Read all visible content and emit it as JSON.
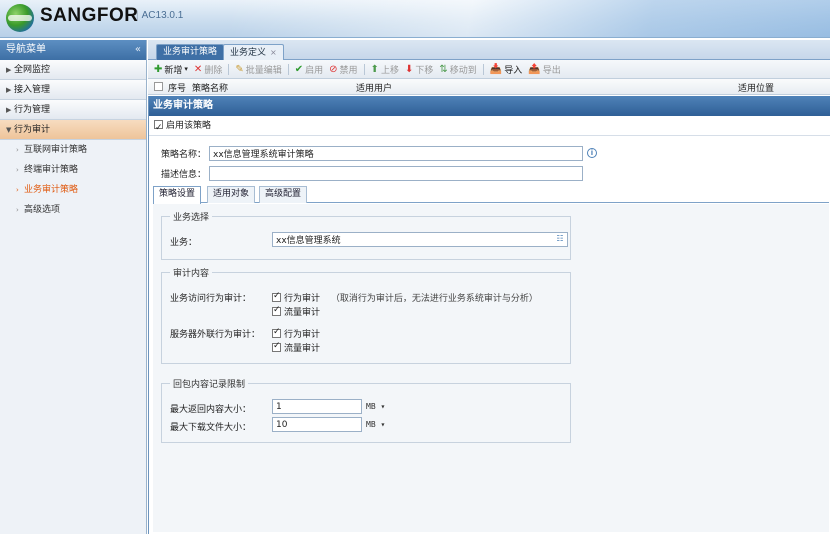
{
  "header": {
    "brand": "SANGFOR",
    "separator": "|",
    "version": "AC13.0.1"
  },
  "sidebar": {
    "title": "导航菜单",
    "collapse_glyph": "«",
    "items": [
      {
        "label": "全网监控"
      },
      {
        "label": "接入管理"
      },
      {
        "label": "行为管理"
      },
      {
        "label": "行为审计",
        "open": true
      }
    ],
    "sub_items": [
      {
        "label": "互联网审计策略"
      },
      {
        "label": "终端审计策略"
      },
      {
        "label": "业务审计策略",
        "active": true
      },
      {
        "label": "高级选项"
      }
    ]
  },
  "tabs": [
    {
      "label": "业务审计策略",
      "active": true
    },
    {
      "label": "业务定义",
      "close": "×"
    }
  ],
  "toolbar": {
    "add": "新增",
    "delete": "删除",
    "batch_edit": "批量编辑",
    "enable": "启用",
    "disable": "禁用",
    "move_up": "上移",
    "move_down": "下移",
    "move_to": "移动到",
    "import": "导入",
    "export": "导出"
  },
  "grid": {
    "col_index": "序号",
    "col_name": "策略名称",
    "col_users": "适用用户",
    "col_location": "适用位置"
  },
  "dialog": {
    "title": "业务审计策略",
    "enable_label": "启用该策略",
    "name_label": "策略名称：",
    "name_value": "xx信息管理系统审计策略",
    "desc_label": "描述信息：",
    "desc_value": "",
    "subtabs": [
      "策略设置",
      "适用对象",
      "高级配置"
    ],
    "business_section": {
      "legend": "业务选择",
      "label": "业务：",
      "value": "xx信息管理系统"
    },
    "audit_section": {
      "legend": "审计内容",
      "access_label": "业务访问行为审计：",
      "access_behavior": "行为审计",
      "access_note": "（取消行为审计后，无法进行业务系统审计与分析）",
      "access_traffic": "流量审计",
      "external_label": "服务器外联行为审计：",
      "external_behavior": "行为审计",
      "external_traffic": "流量审计"
    },
    "limit_section": {
      "legend": "回包内容记录限制",
      "max_return_label": "最大返回内容大小：",
      "max_return_value": "1",
      "max_return_unit": "MB ▾",
      "max_download_label": "最大下载文件大小：",
      "max_download_value": "10",
      "max_download_unit": "MB ▾"
    }
  }
}
